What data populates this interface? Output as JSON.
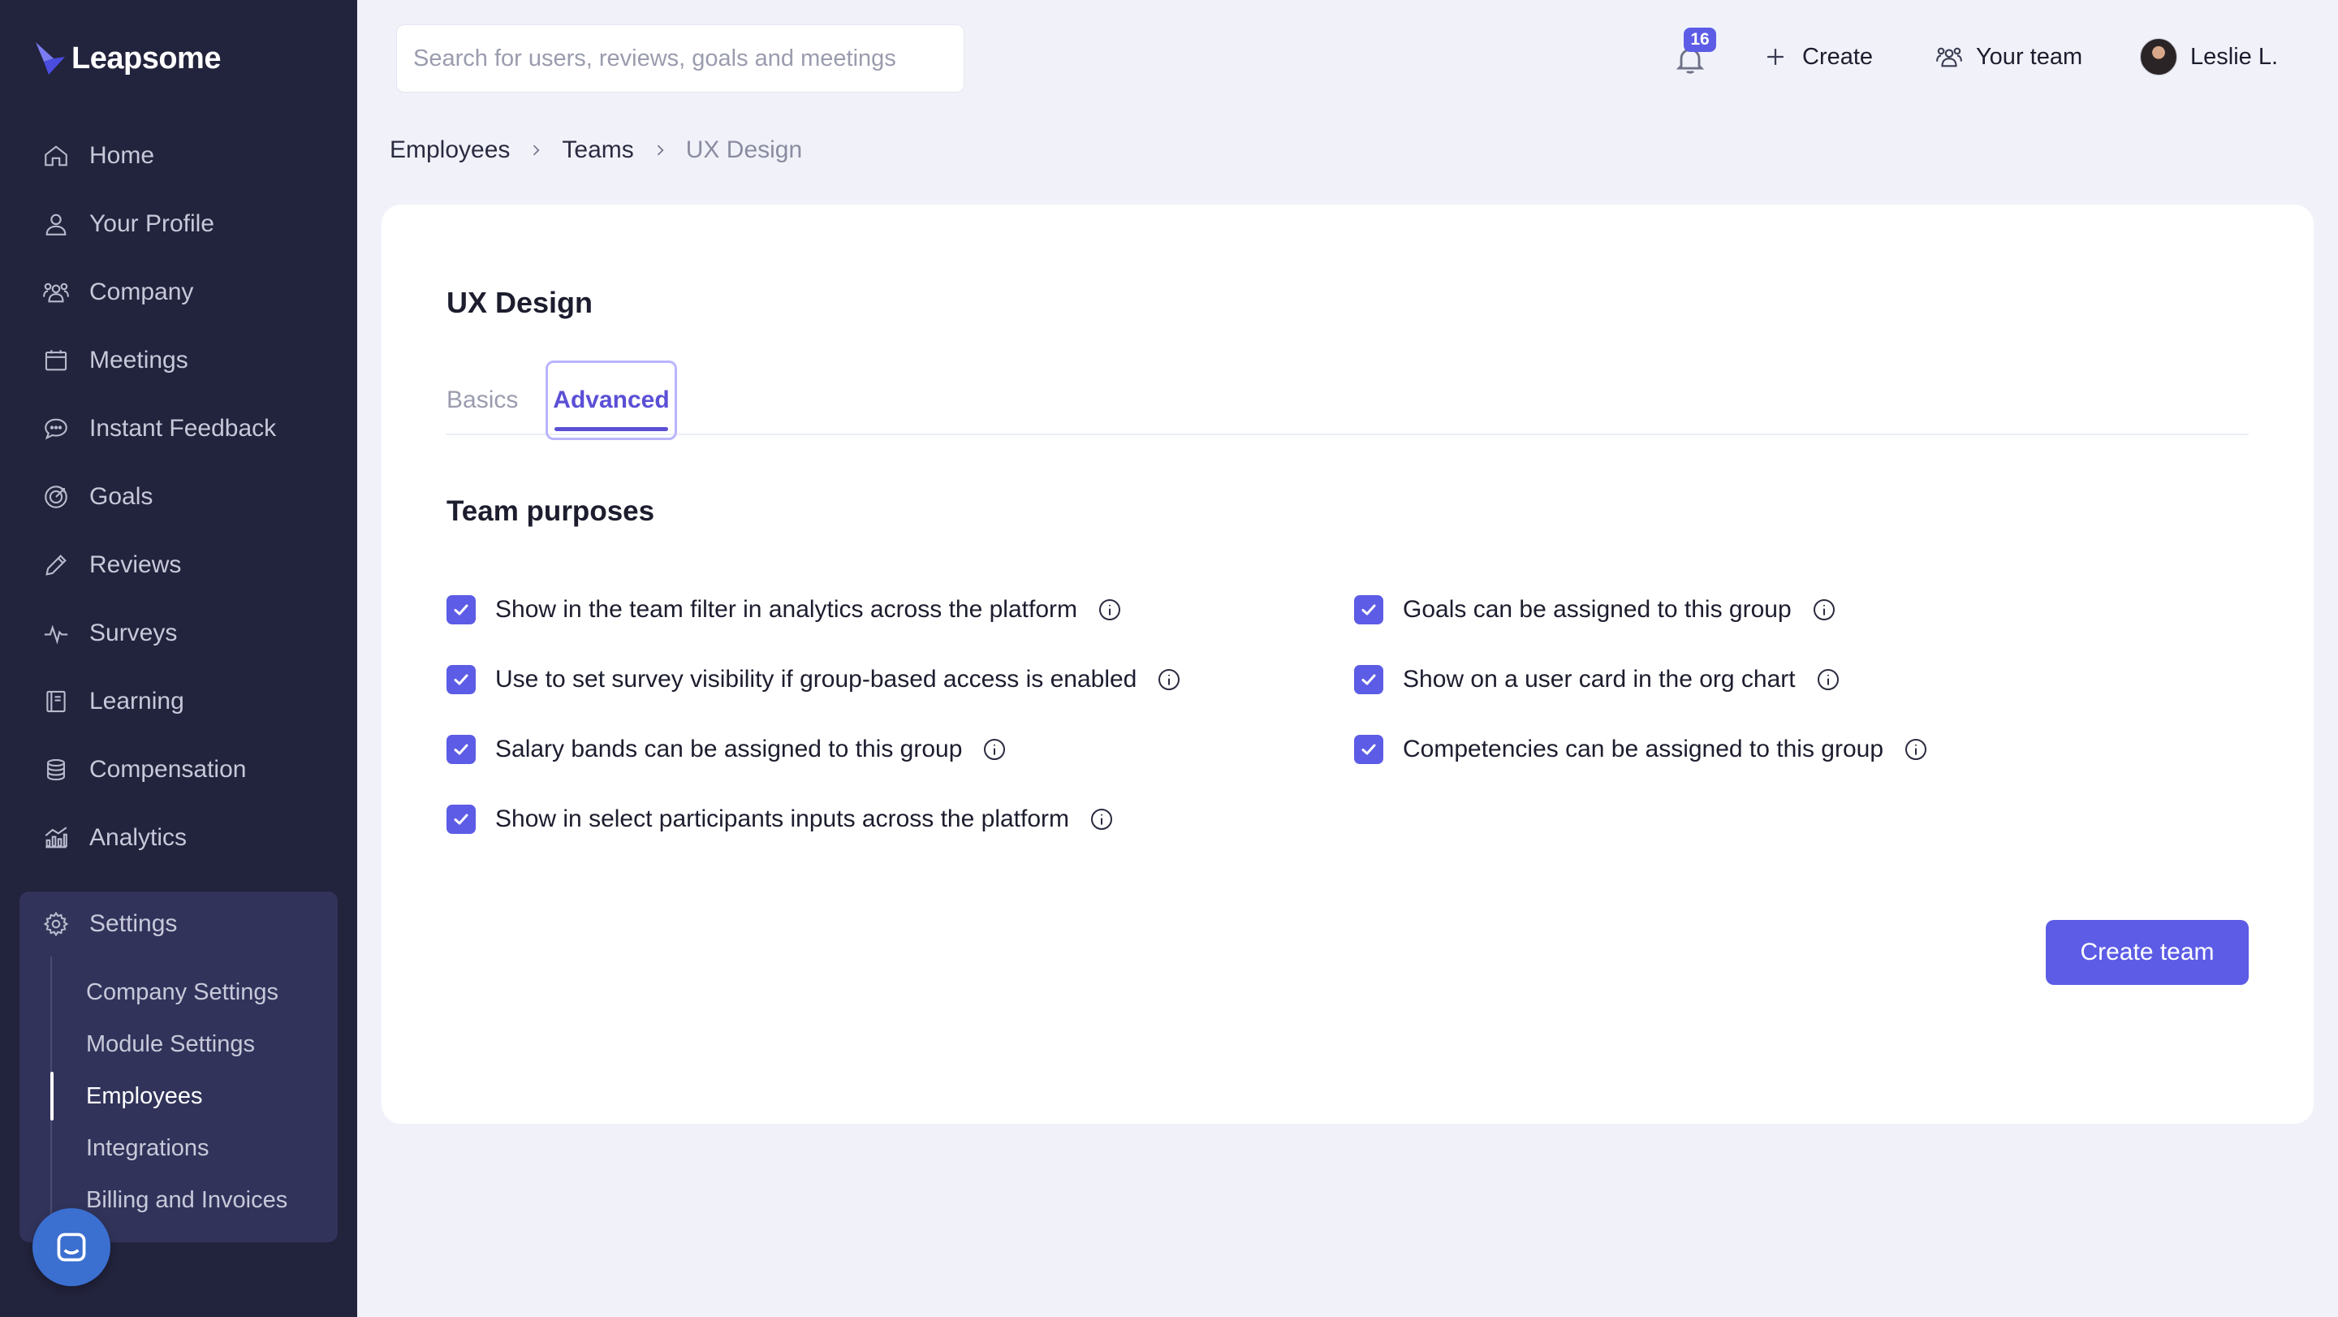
{
  "app": {
    "name": "Leapsome",
    "colors": {
      "sidebar": "#22233c",
      "accent": "#5c5ce6",
      "background": "#f1f2f9"
    }
  },
  "sidebar": {
    "items": [
      {
        "label": "Home",
        "icon": "home-icon"
      },
      {
        "label": "Your Profile",
        "icon": "user-icon"
      },
      {
        "label": "Company",
        "icon": "users-icon"
      },
      {
        "label": "Meetings",
        "icon": "calendar-icon"
      },
      {
        "label": "Instant Feedback",
        "icon": "chat-icon"
      },
      {
        "label": "Goals",
        "icon": "target-icon"
      },
      {
        "label": "Reviews",
        "icon": "pencil-icon"
      },
      {
        "label": "Surveys",
        "icon": "pulse-icon"
      },
      {
        "label": "Learning",
        "icon": "book-icon"
      },
      {
        "label": "Compensation",
        "icon": "coins-icon"
      },
      {
        "label": "Analytics",
        "icon": "chart-icon"
      }
    ],
    "settings": {
      "label": "Settings",
      "icon": "gear-icon",
      "subitems": [
        {
          "label": "Company Settings",
          "active": false
        },
        {
          "label": "Module Settings",
          "active": false
        },
        {
          "label": "Employees",
          "active": true
        },
        {
          "label": "Integrations",
          "active": false
        },
        {
          "label": "Billing and Invoices",
          "active": false
        }
      ]
    }
  },
  "topbar": {
    "search_placeholder": "Search for users, reviews, goals and meetings",
    "notifications_count": "16",
    "create_label": "Create",
    "team_label": "Your team",
    "user_name": "Leslie L."
  },
  "breadcrumb": {
    "items": [
      "Employees",
      "Teams"
    ],
    "current": "UX Design"
  },
  "page": {
    "title": "UX Design",
    "tabs": {
      "basics": "Basics",
      "advanced": "Advanced",
      "active": "Advanced"
    },
    "section_title": "Team purposes",
    "options_left": [
      {
        "label": "Show in the team filter in analytics across the platform",
        "checked": true
      },
      {
        "label": "Use to set survey visibility if group-based access is enabled",
        "checked": true
      },
      {
        "label": "Salary bands can be assigned to this group",
        "checked": true
      },
      {
        "label": "Show in select participants inputs across the platform",
        "checked": true
      }
    ],
    "options_right": [
      {
        "label": "Goals can be assigned to this group",
        "checked": true
      },
      {
        "label": "Show on a user card in the org chart",
        "checked": true
      },
      {
        "label": "Competencies can be assigned to this group",
        "checked": true
      }
    ],
    "primary_button": "Create team"
  }
}
